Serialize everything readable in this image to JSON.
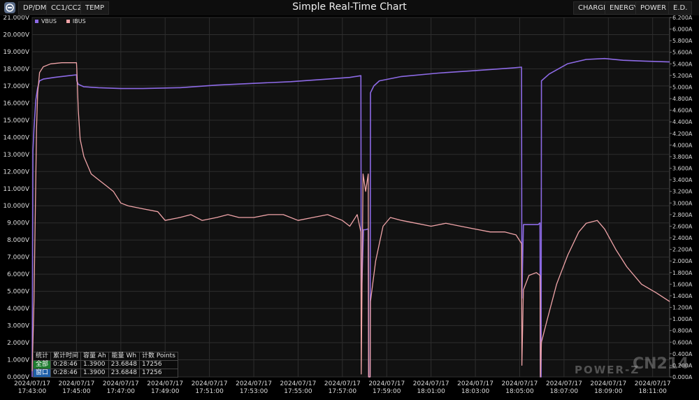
{
  "toolbar": {
    "tabs_left": [
      "DP/DM",
      "CC1/CC2",
      "TEMP"
    ],
    "title": "Simple Real-Time Chart",
    "tabs_right": [
      "CHARGE",
      "ENERGY",
      "POWER",
      "E.D."
    ]
  },
  "legend": [
    {
      "label": "VBUS",
      "color": "#8d6ae6"
    },
    {
      "label": "IBUS",
      "color": "#f0a4a8"
    }
  ],
  "stats": {
    "headers": [
      "统计",
      "累计时间",
      "容量 Ah",
      "能量 Wh",
      "计数 Points"
    ],
    "rows": [
      {
        "label": "全部",
        "values": [
          "0:28:46",
          "1.3900",
          "23.6848",
          "17256"
        ]
      },
      {
        "label": "窗口",
        "values": [
          "0:28:46",
          "1.3900",
          "23.6848",
          "17256"
        ]
      }
    ]
  },
  "watermark": {
    "brand": "POWER-Z",
    "site": "CN214"
  },
  "chart_data": {
    "type": "line",
    "x_unit": "time",
    "x_range": [
      "2024/07/17 17:43:00",
      "2024/07/17 18:11:46"
    ],
    "x_ticks": [
      [
        "2024/07/17",
        "17:43:00"
      ],
      [
        "2024/07/17",
        "17:45:00"
      ],
      [
        "2024/07/17",
        "17:47:00"
      ],
      [
        "2024/07/17",
        "17:49:00"
      ],
      [
        "2024/07/17",
        "17:51:00"
      ],
      [
        "2024/07/17",
        "17:53:00"
      ],
      [
        "2024/07/17",
        "17:55:00"
      ],
      [
        "2024/07/17",
        "17:57:00"
      ],
      [
        "2024/07/17",
        "17:59:00"
      ],
      [
        "2024/07/17",
        "18:01:00"
      ],
      [
        "2024/07/17",
        "18:03:00"
      ],
      [
        "2024/07/17",
        "18:05:00"
      ],
      [
        "2024/07/17",
        "18:07:00"
      ],
      [
        "2024/07/17",
        "18:09:00"
      ],
      [
        "2024/07/17",
        "18:11:00"
      ]
    ],
    "y_left_ticks": [
      "0.000V",
      "1.000V",
      "2.000V",
      "3.000V",
      "4.000V",
      "5.000V",
      "6.000V",
      "7.000V",
      "8.000V",
      "9.000V",
      "10.000V",
      "11.000V",
      "12.000V",
      "13.000V",
      "14.000V",
      "15.000V",
      "16.000V",
      "17.000V",
      "18.000V",
      "19.000V",
      "20.000V",
      "21.000V"
    ],
    "y_left_range": [
      0,
      21
    ],
    "y_right_ticks": [
      "0.000A",
      "0.200A",
      "0.400A",
      "0.600A",
      "0.800A",
      "1.000A",
      "1.200A",
      "1.400A",
      "1.600A",
      "1.800A",
      "2.000A",
      "2.200A",
      "2.400A",
      "2.600A",
      "2.800A",
      "3.000A",
      "3.200A",
      "3.400A",
      "3.600A",
      "3.800A",
      "4.000A",
      "4.200A",
      "4.400A",
      "4.600A",
      "4.800A",
      "5.000A",
      "5.200A",
      "5.400A",
      "5.600A",
      "5.800A",
      "6.000A",
      "6.200A"
    ],
    "y_right_range": [
      0,
      6.2
    ],
    "grid": true,
    "series": [
      {
        "name": "VBUS",
        "axis": "left",
        "unit": "V",
        "color": "#8d6ae6",
        "points": [
          [
            0,
            0
          ],
          [
            2,
            13.2
          ],
          [
            5,
            14.5
          ],
          [
            10,
            16.2
          ],
          [
            15,
            16.9
          ],
          [
            20,
            17.3
          ],
          [
            30,
            17.4
          ],
          [
            60,
            17.5
          ],
          [
            100,
            17.6
          ],
          [
            120,
            17.65
          ],
          [
            121,
            17.3
          ],
          [
            125,
            17.1
          ],
          [
            140,
            16.95
          ],
          [
            180,
            16.9
          ],
          [
            240,
            16.85
          ],
          [
            300,
            16.85
          ],
          [
            400,
            16.9
          ],
          [
            500,
            17.05
          ],
          [
            600,
            17.15
          ],
          [
            700,
            17.25
          ],
          [
            800,
            17.4
          ],
          [
            860,
            17.5
          ],
          [
            890,
            17.6
          ],
          [
            891,
            4.2
          ],
          [
            897,
            8.6
          ],
          [
            903,
            8.6
          ],
          [
            910,
            8.65
          ],
          [
            911,
            0
          ],
          [
            915,
            0
          ],
          [
            916,
            16.6
          ],
          [
            925,
            17.0
          ],
          [
            940,
            17.3
          ],
          [
            1000,
            17.55
          ],
          [
            1100,
            17.75
          ],
          [
            1200,
            17.9
          ],
          [
            1300,
            18.05
          ],
          [
            1325,
            18.1
          ],
          [
            1326,
            4.6
          ],
          [
            1330,
            8.9
          ],
          [
            1370,
            8.9
          ],
          [
            1375,
            9.0
          ],
          [
            1376,
            0
          ],
          [
            1378,
            0
          ],
          [
            1379,
            17.3
          ],
          [
            1400,
            17.7
          ],
          [
            1450,
            18.3
          ],
          [
            1500,
            18.55
          ],
          [
            1550,
            18.6
          ],
          [
            1600,
            18.5
          ],
          [
            1660,
            18.45
          ],
          [
            1726,
            18.4
          ]
        ]
      },
      {
        "name": "IBUS",
        "axis": "right",
        "unit": "A",
        "color": "#f0a4a8",
        "points": [
          [
            0,
            0.1
          ],
          [
            2,
            0.6
          ],
          [
            5,
            1.3
          ],
          [
            8,
            2.6
          ],
          [
            12,
            4.3
          ],
          [
            15,
            4.9
          ],
          [
            20,
            5.25
          ],
          [
            30,
            5.35
          ],
          [
            50,
            5.4
          ],
          [
            80,
            5.42
          ],
          [
            120,
            5.42
          ],
          [
            121,
            5.3
          ],
          [
            125,
            4.6
          ],
          [
            130,
            4.1
          ],
          [
            140,
            3.8
          ],
          [
            160,
            3.5
          ],
          [
            180,
            3.4
          ],
          [
            200,
            3.3
          ],
          [
            220,
            3.2
          ],
          [
            240,
            3.0
          ],
          [
            260,
            2.95
          ],
          [
            300,
            2.9
          ],
          [
            340,
            2.85
          ],
          [
            360,
            2.7
          ],
          [
            400,
            2.75
          ],
          [
            430,
            2.8
          ],
          [
            460,
            2.7
          ],
          [
            500,
            2.75
          ],
          [
            530,
            2.8
          ],
          [
            560,
            2.75
          ],
          [
            600,
            2.75
          ],
          [
            640,
            2.8
          ],
          [
            680,
            2.8
          ],
          [
            720,
            2.7
          ],
          [
            760,
            2.75
          ],
          [
            800,
            2.8
          ],
          [
            840,
            2.7
          ],
          [
            860,
            2.6
          ],
          [
            880,
            2.8
          ],
          [
            890,
            2.5
          ],
          [
            891,
            0.05
          ],
          [
            896,
            3.5
          ],
          [
            903,
            3.2
          ],
          [
            910,
            3.5
          ],
          [
            911,
            0
          ],
          [
            915,
            0
          ],
          [
            916,
            1.3
          ],
          [
            930,
            2.0
          ],
          [
            950,
            2.6
          ],
          [
            970,
            2.75
          ],
          [
            1000,
            2.7
          ],
          [
            1040,
            2.65
          ],
          [
            1080,
            2.6
          ],
          [
            1120,
            2.65
          ],
          [
            1160,
            2.6
          ],
          [
            1200,
            2.55
          ],
          [
            1240,
            2.5
          ],
          [
            1280,
            2.5
          ],
          [
            1310,
            2.45
          ],
          [
            1325,
            2.3
          ],
          [
            1326,
            0.2
          ],
          [
            1330,
            1.5
          ],
          [
            1345,
            1.75
          ],
          [
            1365,
            1.8
          ],
          [
            1375,
            1.75
          ],
          [
            1376,
            0
          ],
          [
            1379,
            0.6
          ],
          [
            1395,
            1.0
          ],
          [
            1420,
            1.6
          ],
          [
            1450,
            2.1
          ],
          [
            1480,
            2.5
          ],
          [
            1500,
            2.65
          ],
          [
            1530,
            2.7
          ],
          [
            1550,
            2.55
          ],
          [
            1580,
            2.2
          ],
          [
            1610,
            1.9
          ],
          [
            1650,
            1.6
          ],
          [
            1690,
            1.45
          ],
          [
            1726,
            1.3
          ]
        ]
      }
    ]
  }
}
